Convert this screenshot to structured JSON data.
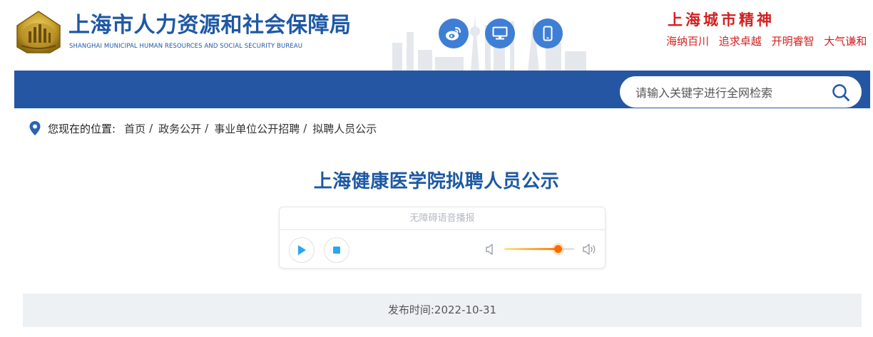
{
  "header": {
    "org_name_cn": "上海市人力资源和社会保障局",
    "org_name_en": "SHANGHAI MUNICIPAL HUMAN RESOURCES AND SOCIAL SECURITY BUREAU",
    "social_icons": [
      "weibo-icon",
      "desktop-icon",
      "mobile-icon"
    ],
    "spirit_title": "上海城市精神",
    "spirit_slogans": [
      "海纳百川",
      "追求卓越",
      "开明睿智",
      "大气谦和"
    ]
  },
  "search": {
    "placeholder": "请输入关键字进行全网检索"
  },
  "breadcrumb": {
    "label": "您现在的位置:",
    "items": [
      "首页",
      "政务公开",
      "事业单位公开招聘",
      "拟聘人员公示"
    ],
    "separator": "/"
  },
  "article": {
    "title": "上海健康医学院拟聘人员公示",
    "publish_label": "发布时间:2022-10-31"
  },
  "player": {
    "title": "无障碍语音播报",
    "volume_level": 0.77
  },
  "colors": {
    "brand_blue": "#2556a3",
    "title_blue": "#1d58a3",
    "spirit_red": "#d21f1f",
    "icon_blue": "#3e7fd5",
    "play_blue": "#2aa6f0"
  }
}
